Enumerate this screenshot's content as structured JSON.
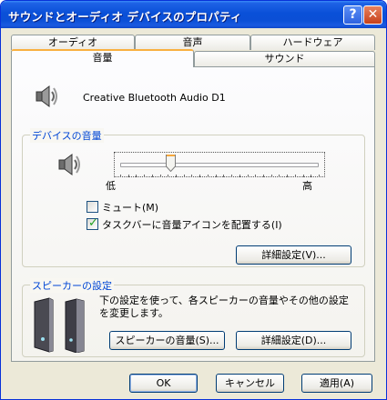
{
  "window": {
    "title": "サウンドとオーディオ デバイスのプロパティ",
    "help_glyph": "?",
    "close_glyph": "✕"
  },
  "tabs": {
    "row_back": [
      "オーディオ",
      "音声",
      "ハードウェア"
    ],
    "row_front": [
      "音量",
      "サウンド"
    ],
    "active": "音量"
  },
  "device": {
    "name": "Creative Bluetooth Audio D1"
  },
  "volume_group": {
    "title": "デバイスの音量",
    "min_label": "低",
    "max_label": "高",
    "level": 0.25,
    "mute_label": "ミュート(M)",
    "mute_checked": false,
    "taskbar_label": "タスクバーに音量アイコンを配置する(I)",
    "taskbar_checked": true,
    "advanced_button": "詳細設定(V)..."
  },
  "speaker_group": {
    "title": "スピーカーの設定",
    "description": "下の設定を使って、各スピーカーの音量やその他の設定を変更します。",
    "volume_button": "スピーカーの音量(S)...",
    "advanced_button": "詳細設定(D)..."
  },
  "footer": {
    "ok": "OK",
    "cancel": "キャンセル",
    "apply": "適用(A)"
  }
}
